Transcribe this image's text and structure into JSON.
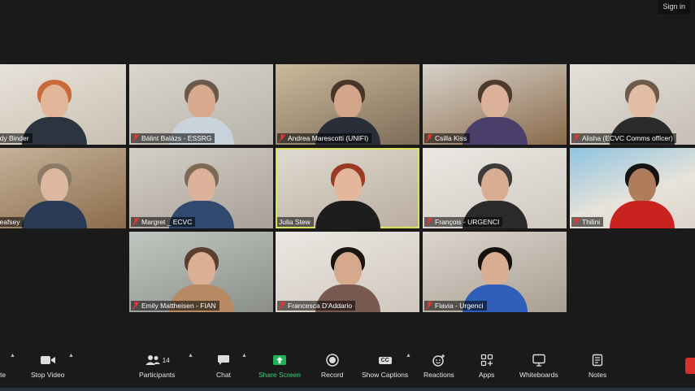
{
  "header": {
    "signin_label": "Sign in"
  },
  "participants_tiles": [
    {
      "name": "indy Binder"
    },
    {
      "name": "Bálint Balázs - ESSRG"
    },
    {
      "name": "Andrea Marescotti (UNIFI)"
    },
    {
      "name": "Csilla Kiss"
    },
    {
      "name": "Alisha (ECVC Comms officer)"
    },
    {
      "name": "a Kneafsey"
    },
    {
      "name": "Margret _ ECVC"
    },
    {
      "name": "Julia Stew"
    },
    {
      "name": "François - URGENCI"
    },
    {
      "name": "Thilini"
    },
    {
      "name": "Emily Mattheisen - FIAN"
    },
    {
      "name": "Francesca D'Addario"
    },
    {
      "name": "Flavia - Urgenci"
    }
  ],
  "toolbar": {
    "mute_partial": "te",
    "stop_video": "Stop Video",
    "participants": "Participants",
    "participants_count": "14",
    "chat": "Chat",
    "share_screen": "Share Screen",
    "record": "Record",
    "show_captions": "Show Captions",
    "reactions": "Reactions",
    "apps": "Apps",
    "whiteboards": "Whiteboards",
    "notes": "Notes",
    "captions_icon_text": "CC"
  },
  "colors": {
    "active_speaker": "#d8e25a",
    "share_green": "#3fd17a",
    "end_red": "#d9302a"
  }
}
